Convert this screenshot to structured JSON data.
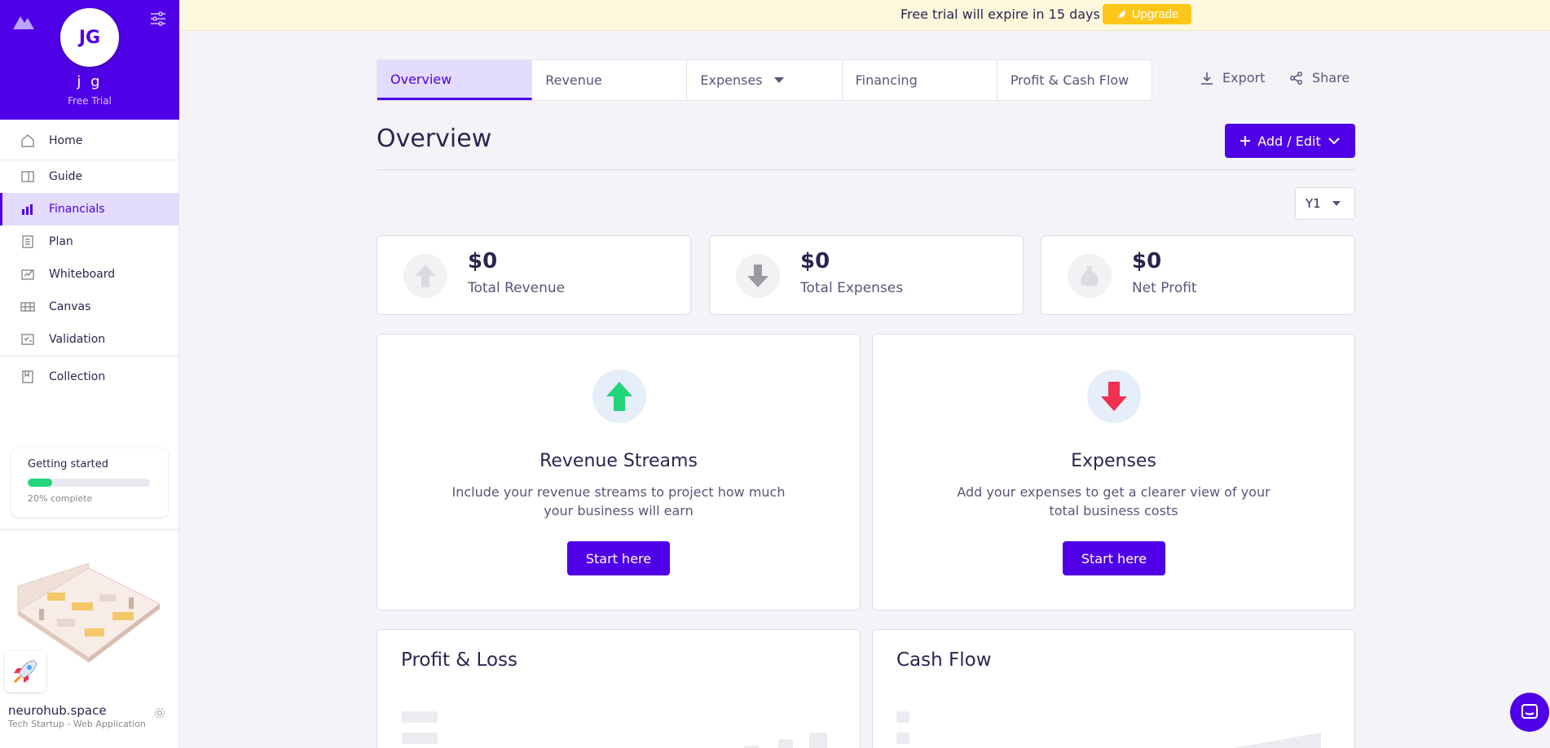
{
  "banner": {
    "text": "Free trial will expire in 15 days",
    "upgrade_label": "Upgrade"
  },
  "user": {
    "initials": "JG",
    "name": "j g",
    "plan": "Free Trial"
  },
  "sidebar": {
    "items": [
      {
        "label": "Home",
        "icon": "home-icon"
      },
      {
        "label": "Guide",
        "icon": "guide-icon"
      },
      {
        "label": "Financials",
        "icon": "bar-chart-icon"
      },
      {
        "label": "Plan",
        "icon": "plan-icon"
      },
      {
        "label": "Whiteboard",
        "icon": "whiteboard-icon"
      },
      {
        "label": "Canvas",
        "icon": "canvas-icon"
      },
      {
        "label": "Validation",
        "icon": "validation-icon"
      },
      {
        "label": "Collection",
        "icon": "collection-icon"
      }
    ],
    "active": "Financials"
  },
  "getting_started": {
    "title": "Getting started",
    "progress": 0.2,
    "progress_label": "20% complete"
  },
  "project": {
    "name": "neurohub.space",
    "subtitle": "Tech Startup - Web Application"
  },
  "tabs": [
    {
      "label": "Overview"
    },
    {
      "label": "Revenue"
    },
    {
      "label": "Expenses"
    },
    {
      "label": "Financing"
    },
    {
      "label": "Profit & Cash Flow"
    }
  ],
  "toolbar": {
    "export_label": "Export",
    "share_label": "Share"
  },
  "page": {
    "title": "Overview",
    "add_edit_label": "Add / Edit",
    "year": "Y1"
  },
  "stats": [
    {
      "value": "$0",
      "label": "Total Revenue"
    },
    {
      "value": "$0",
      "label": "Total Expenses"
    },
    {
      "value": "$0",
      "label": "Net Profit"
    }
  ],
  "cards": {
    "revenue": {
      "title": "Revenue Streams",
      "desc": "Include your revenue streams to project how much your business will earn",
      "button": "Start here"
    },
    "expenses": {
      "title": "Expenses",
      "desc": "Add your expenses to get a clearer view of your total business costs",
      "button": "Start here"
    }
  },
  "bottom": {
    "pl_title": "Profit & Loss",
    "cf_title": "Cash Flow"
  },
  "colors": {
    "brand": "#5000e6",
    "banner_bg": "#fdf8dc",
    "upgrade": "#ffc61a",
    "progress": "#22d47a",
    "up_arrow": "#22d47a",
    "down_arrow": "#f0314f"
  }
}
